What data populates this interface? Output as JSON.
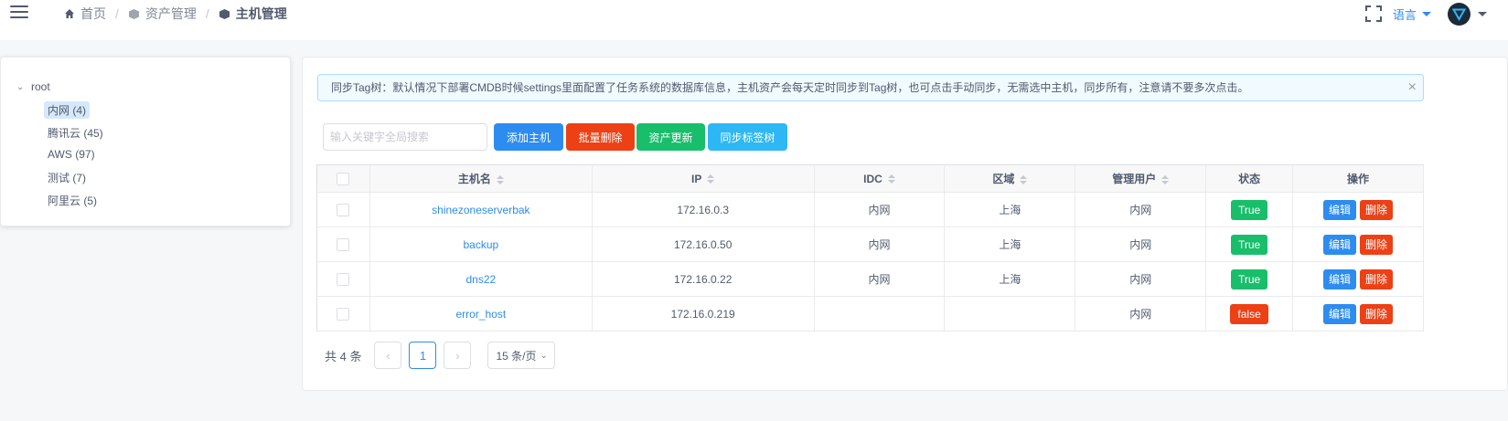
{
  "breadcrumb": {
    "home": "首页",
    "assets": "资产管理",
    "hosts": "主机管理"
  },
  "header": {
    "language": "语言"
  },
  "tree": {
    "root": "root",
    "nodes": [
      "内网 (4)",
      "腾讯云 (45)",
      "AWS (97)",
      "测试 (7)",
      "阿里云 (5)"
    ],
    "selected_index": 0
  },
  "alert": {
    "text": "同步Tag树：默认情况下部署CMDB时候settings里面配置了任务系统的数据库信息，主机资产会每天定时同步到Tag树，也可点击手动同步，无需选中主机，同步所有，注意请不要多次点击。"
  },
  "toolbar": {
    "search_placeholder": "输入关键字全局搜索",
    "add": "添加主机",
    "bulk_delete": "批量删除",
    "update": "资产更新",
    "sync": "同步标签树"
  },
  "table": {
    "columns": [
      "主机名",
      "IP",
      "IDC",
      "区域",
      "管理用户",
      "状态",
      "操作"
    ],
    "rows": [
      {
        "hostname": "shinezoneserverbak",
        "ip": "172.16.0.3",
        "idc": "内网",
        "region": "上海",
        "admin_user": "内网",
        "status": "True"
      },
      {
        "hostname": "backup",
        "ip": "172.16.0.50",
        "idc": "内网",
        "region": "上海",
        "admin_user": "内网",
        "status": "True"
      },
      {
        "hostname": "dns22",
        "ip": "172.16.0.22",
        "idc": "内网",
        "region": "上海",
        "admin_user": "内网",
        "status": "True"
      },
      {
        "hostname": "error_host",
        "ip": "172.16.0.219",
        "idc": "",
        "region": "",
        "admin_user": "内网",
        "status": "false"
      }
    ],
    "edit_label": "编辑",
    "delete_label": "删除"
  },
  "pagination": {
    "total": "共 4 条",
    "current_page": "1",
    "page_size": "15 条/页"
  },
  "colors": {
    "primary": "#2d8cf0",
    "success": "#19be6b",
    "error": "#ed4014",
    "info": "#2db7f5"
  }
}
